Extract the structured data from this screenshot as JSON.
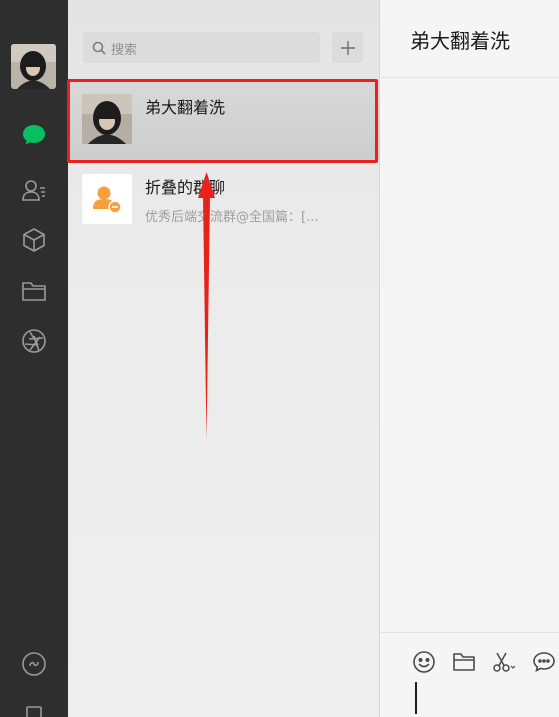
{
  "nav": {
    "user_avatar": "user-avatar",
    "icons": [
      "chat-icon",
      "contacts-icon",
      "favorites-cube-icon",
      "files-folder-icon",
      "moments-aperture-icon",
      "mini-program-icon",
      "phone-icon"
    ],
    "active_color": "#07c160"
  },
  "search": {
    "placeholder": "搜索"
  },
  "add_button": {
    "icon": "plus-icon"
  },
  "chat_list": [
    {
      "name": "弟大翻着洗",
      "preview": "",
      "selected": true
    },
    {
      "name": "折叠的群聊",
      "preview": "优秀后端交流群@全国篇：[...",
      "icon": "folded-group-icon",
      "icon_color": "#fa9d3b"
    }
  ],
  "chat": {
    "title": "弟大翻着洗",
    "toolbar": [
      "emoji-icon",
      "folder-icon",
      "scissors-icon",
      "message-icon"
    ]
  },
  "annotation": {
    "box_color": "#e8211b"
  }
}
